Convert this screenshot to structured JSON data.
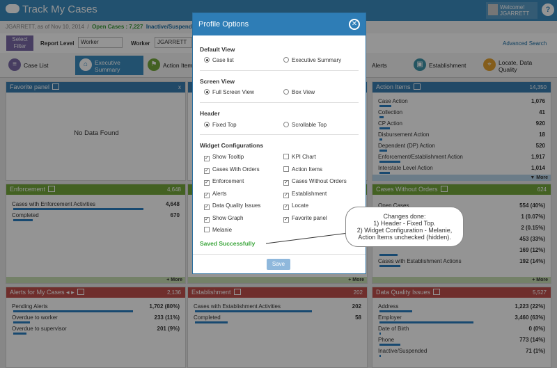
{
  "header": {
    "app_title": "Track My Cases",
    "welcome": "Welcome!",
    "user": "JGARRETT",
    "help": "?"
  },
  "subbar": {
    "user_date": "JGARRETT, as of Nov 10, 2014",
    "sep": "/",
    "open_cases": "Open Cases : 7,227",
    "inactive": "Inactive/Suspended"
  },
  "filter": {
    "select_filter": "Select Filter",
    "report_level_label": "Report Level",
    "report_level_value": "Worker",
    "worker_label": "Worker",
    "worker_value": "JGARRETT",
    "advanced": "Advanced Search"
  },
  "tabs": [
    {
      "label": "Case List"
    },
    {
      "label": "Executive Summary"
    },
    {
      "label": "Action Items"
    },
    {
      "label": "Alerts"
    },
    {
      "label": "Establishment"
    },
    {
      "label": "Locate, Data Quality"
    }
  ],
  "panels": {
    "favorite": {
      "title": "Favorite panel",
      "close": "x",
      "empty": "No Data Found"
    },
    "action_items": {
      "title": "Action Items",
      "count": "14,350",
      "rows": [
        {
          "name": "Case Action",
          "value": "1,076",
          "pct": 0.08
        },
        {
          "name": "Collection",
          "value": "41",
          "pct": 0.03
        },
        {
          "name": "CP Action",
          "value": "920",
          "pct": 0.07
        },
        {
          "name": "Disbursement Action",
          "value": "18",
          "pct": 0.02
        },
        {
          "name": "Dependent (DP) Action",
          "value": "520",
          "pct": 0.05
        },
        {
          "name": "Enforcement/Establishment Action",
          "value": "1,917",
          "pct": 0.14
        },
        {
          "name": "Interstate Level Action",
          "value": "1,014",
          "pct": 0.07
        }
      ],
      "more": "▼ More"
    },
    "enforcement": {
      "title": "Enforcement",
      "count": "4,648",
      "rows": [
        {
          "name": "Cases with Enforcement Activities",
          "value": "4,648",
          "pct": 0.87
        },
        {
          "name": "Completed",
          "value": "670",
          "pct": 0.13
        }
      ],
      "more": "+ More"
    },
    "middle_more": "+ More",
    "without_orders": {
      "title": "Cases Without Orders",
      "count": "624",
      "rows": [
        {
          "name": "Open Cases",
          "value": "554 (40%)",
          "pct": 0.4
        },
        {
          "name": "",
          "value": "1 (0.07%)",
          "pct": 0.01
        },
        {
          "name": "",
          "value": "2 (0.15%)",
          "pct": 0.01
        },
        {
          "name": "",
          "value": "453 (33%)",
          "pct": 0.33
        },
        {
          "name": "",
          "value": "169 (12%)",
          "pct": 0.12
        },
        {
          "name": "Cases with Establishment Actions",
          "value": "192 (14%)",
          "pct": 0.14
        }
      ],
      "more": "+ More"
    },
    "alerts": {
      "title": "Alerts for My Cases",
      "arrows": "◂ ▸",
      "count": "2,136",
      "rows": [
        {
          "name": "Pending Alerts",
          "value": "1,702 (80%)",
          "pct": 0.8
        },
        {
          "name": "Overdue to worker",
          "value": "233 (11%)",
          "pct": 0.11
        },
        {
          "name": "Overdue to supervisor",
          "value": "201 (9%)",
          "pct": 0.09
        }
      ]
    },
    "establishment": {
      "title": "Establishment",
      "count": "202",
      "rows": [
        {
          "name": "Cases with Establishment Activities",
          "value": "202",
          "pct": 0.78
        },
        {
          "name": "Completed",
          "value": "58",
          "pct": 0.22
        }
      ]
    },
    "data_quality": {
      "title": "Data Quality Issues",
      "count": "5,527",
      "rows": [
        {
          "name": "Address",
          "value": "1,223 (22%)",
          "pct": 0.22
        },
        {
          "name": "Employer",
          "value": "3,460 (63%)",
          "pct": 0.63
        },
        {
          "name": "Date of Birth",
          "value": "0 (0%)",
          "pct": 0.0
        },
        {
          "name": "Phone",
          "value": "773 (14%)",
          "pct": 0.14
        },
        {
          "name": "Inactive/Suspended",
          "value": "71 (1%)",
          "pct": 0.01
        }
      ]
    }
  },
  "modal": {
    "title": "Profile Options",
    "close": "✕",
    "default_view": {
      "label": "Default View",
      "opt1": "Case list",
      "opt2": "Executive Summary"
    },
    "screen_view": {
      "label": "Screen View",
      "opt1": "Full Screen View",
      "opt2": "Box View"
    },
    "header_opt": {
      "label": "Header",
      "opt1": "Fixed Top",
      "opt2": "Scrollable Top"
    },
    "widgets": {
      "label": "Widget Configurations",
      "items": [
        {
          "label": "Show Tooltip",
          "checked": true
        },
        {
          "label": "KPI Chart",
          "checked": false
        },
        {
          "label": "Cases With Orders",
          "checked": true
        },
        {
          "label": "Action Items",
          "checked": false
        },
        {
          "label": "Enforcement",
          "checked": true
        },
        {
          "label": "Cases Without Orders",
          "checked": true
        },
        {
          "label": "Alerts",
          "checked": true
        },
        {
          "label": "Establishment",
          "checked": true
        },
        {
          "label": "Data Quality Issues",
          "checked": true
        },
        {
          "label": "Locate",
          "checked": true
        },
        {
          "label": "Show Graph",
          "checked": true
        },
        {
          "label": "Favorite panel",
          "checked": true
        },
        {
          "label": "Melanie",
          "checked": false
        }
      ]
    },
    "saved": "Saved Successfully",
    "save_button": "Save"
  },
  "callout": {
    "line1": "Changes done:",
    "line2": "1) Header - Fixed Top.",
    "line3": "2) Widget Configuration - Melanie,",
    "line4": "Action Items unchecked (hidden)."
  },
  "colors": {
    "header": "#3b8cc0",
    "modal_header": "#2e7db6",
    "success": "#3aa53a"
  }
}
